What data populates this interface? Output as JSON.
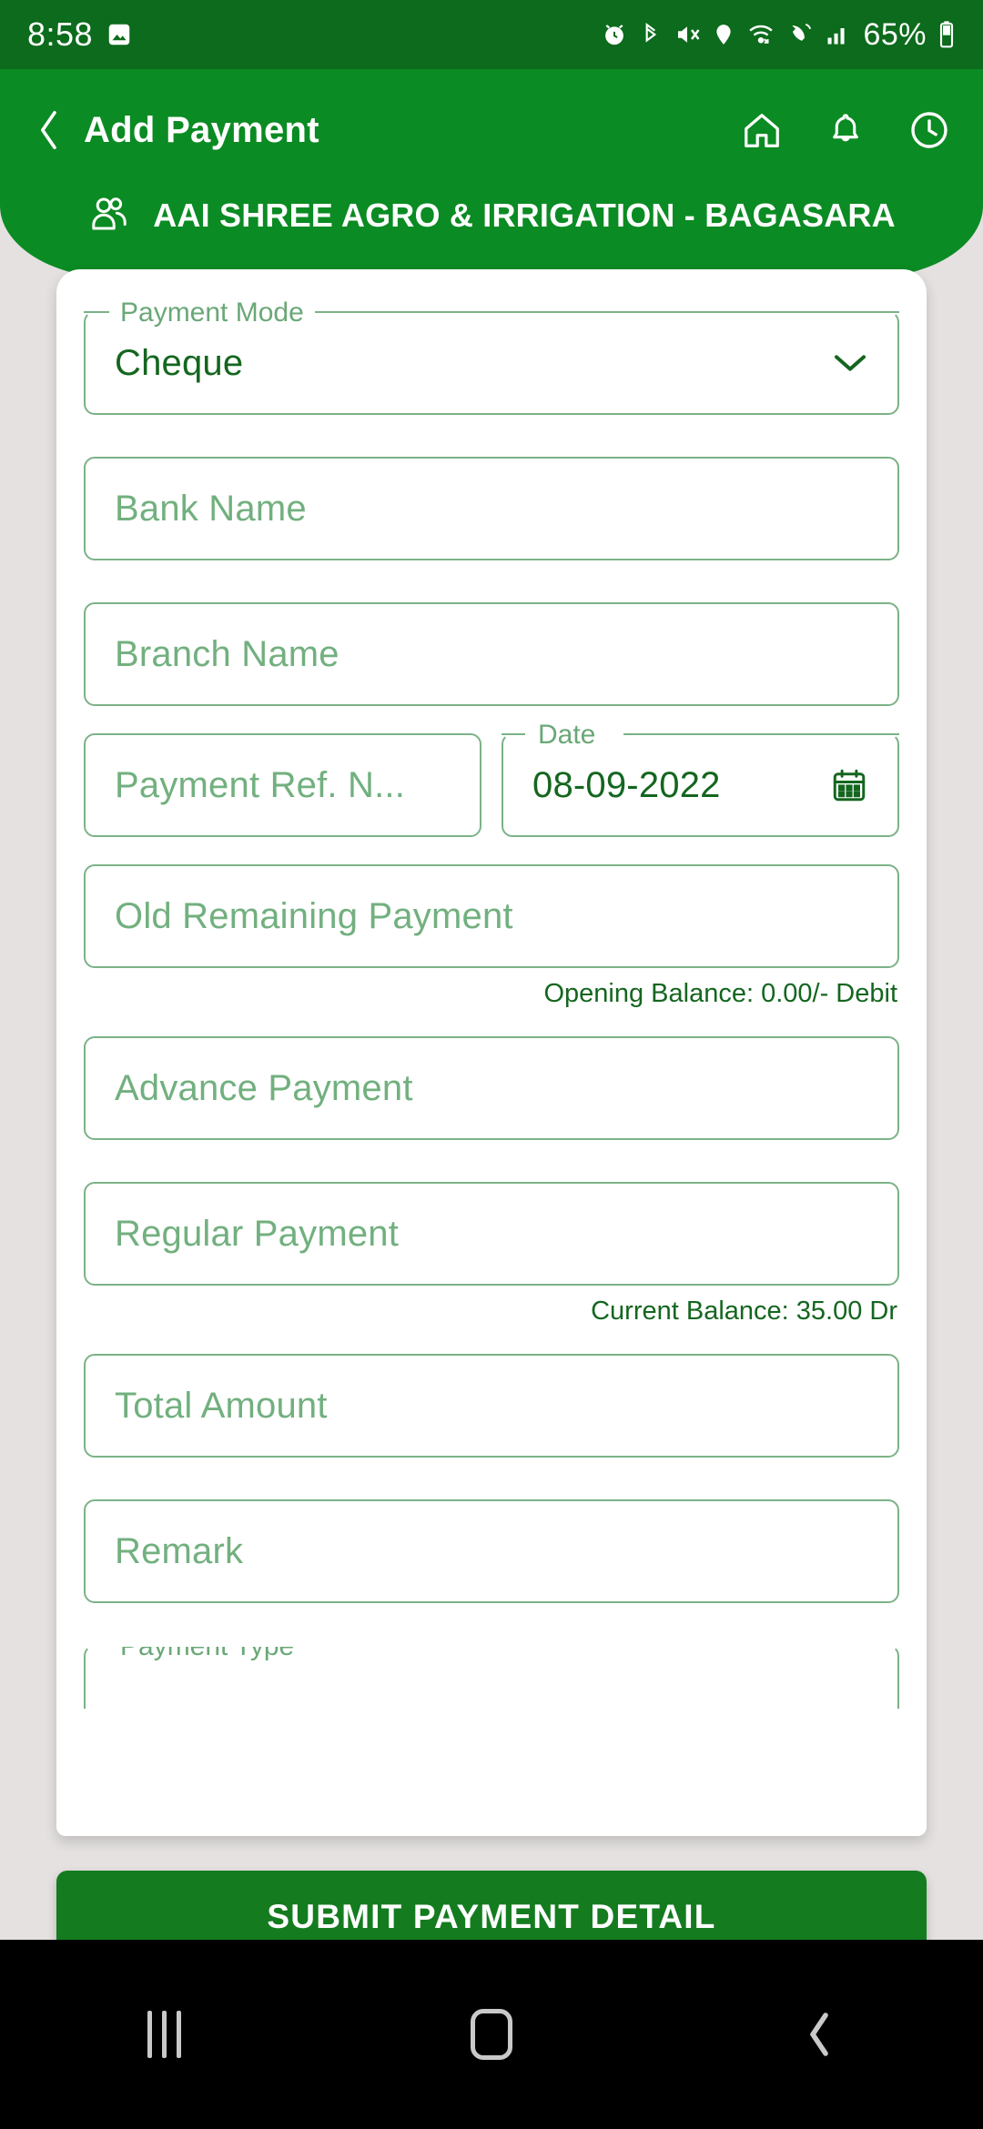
{
  "status_bar": {
    "time": "8:58",
    "battery_percent": "65%",
    "icons": [
      "image-icon",
      "alarm-icon",
      "bluetooth-icon",
      "mute-icon",
      "location-icon",
      "wifi-icon",
      "call-icon",
      "signal-icon",
      "battery-icon"
    ]
  },
  "header": {
    "back_icon": "back-chevron-icon",
    "title": "Add Payment",
    "actions": [
      "home-icon",
      "bell-icon",
      "clock-icon"
    ],
    "customer_icon": "people-icon",
    "customer_name": "AAI SHREE AGRO & IRRIGATION - BAGASARA",
    "bg_color": "#0b8b23"
  },
  "form": {
    "payment_mode": {
      "label": "Payment Mode",
      "value": "Cheque",
      "dropdown_icon": "chevron-down-icon"
    },
    "bank_name": {
      "placeholder": "Bank Name",
      "value": ""
    },
    "branch_name": {
      "placeholder": "Branch Name",
      "value": ""
    },
    "payment_ref_no": {
      "placeholder": "Payment Ref. N...",
      "value": ""
    },
    "date": {
      "label": "Date",
      "value": "08-09-2022",
      "calendar_icon": "calendar-icon"
    },
    "old_remaining_payment": {
      "placeholder": "Old Remaining Payment",
      "value": ""
    },
    "opening_balance_helper": "Opening Balance: 0.00/- Debit",
    "advance_payment": {
      "placeholder": "Advance Payment",
      "value": ""
    },
    "regular_payment": {
      "placeholder": "Regular Payment",
      "value": ""
    },
    "current_balance_helper": "Current Balance: 35.00 Dr",
    "total_amount": {
      "placeholder": "Total Amount",
      "value": ""
    },
    "remark": {
      "placeholder": "Remark",
      "value": ""
    },
    "payment_type": {
      "label": "Payment Type",
      "value": ""
    }
  },
  "submit_button": {
    "label": "SUBMIT PAYMENT DETAIL",
    "color": "#147c1f"
  },
  "nav_bar": {
    "recents_icon": "recents-icon",
    "home_icon": "home-square-icon",
    "back_icon": "back-chevron-icon"
  },
  "colors": {
    "brand_green": "#0b8b23",
    "status_bar_green": "#0c6b1c",
    "field_border": "#7cb287",
    "label_green": "#6aa877",
    "value_green": "#14661f",
    "page_background": "#e4e1e0"
  }
}
